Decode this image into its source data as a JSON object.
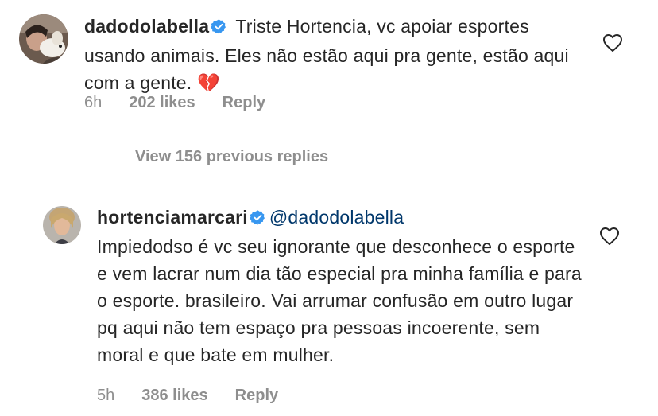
{
  "comments": [
    {
      "username": "dadodolabella",
      "verified": true,
      "text": " Triste Hortencia, vc apoiar esportes usando animais. Eles não estão aqui pra gente, estão aqui com a gente. ",
      "emoji": "💔",
      "time": "6h",
      "likes": "202 likes",
      "reply_label": "Reply",
      "like_icon": "heart-outline-icon"
    },
    {
      "username": "hortenciamarcari",
      "verified": true,
      "mention": "@dadodolabella",
      "text": "Impiedodso é vc seu ignorante que desconhece o esporte e vem lacrar num dia tão especial pra minha família e para o esporte.  brasileiro. Vai arrumar confusão em outro lugar pq aqui não tem espaço pra  pessoas incoerente, sem moral e que bate em mulher.",
      "time": "5h",
      "likes": "386 likes",
      "reply_label": "Reply",
      "like_icon": "heart-outline-icon"
    }
  ],
  "view_replies_label": "View 156 previous replies",
  "colors": {
    "text": "#262626",
    "secondary": "#8e8e8e",
    "verified": "#3897f0",
    "mention": "#00376b"
  }
}
